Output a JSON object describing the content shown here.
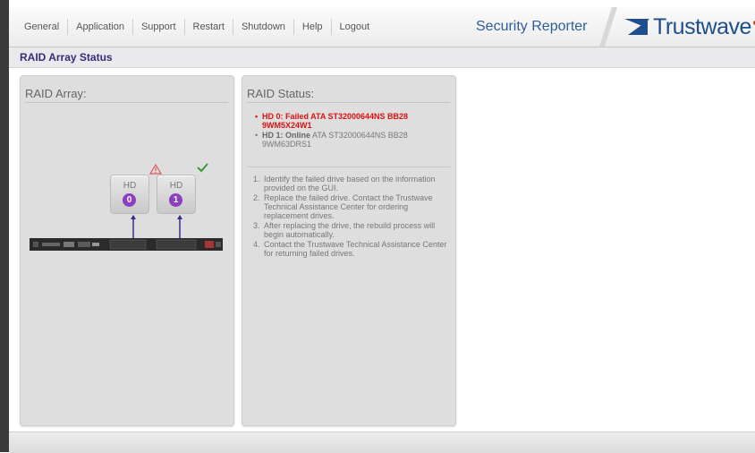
{
  "nav": {
    "items": [
      {
        "label": "General",
        "name": "nav-general"
      },
      {
        "label": "Application",
        "name": "nav-application"
      },
      {
        "label": "Support",
        "name": "nav-support"
      },
      {
        "label": "Restart",
        "name": "nav-restart"
      },
      {
        "label": "Shutdown",
        "name": "nav-shutdown"
      },
      {
        "label": "Help",
        "name": "nav-help"
      },
      {
        "label": "Logout",
        "name": "nav-logout"
      }
    ]
  },
  "brand": {
    "product": "Security Reporter",
    "logo_text": "Trustwave",
    "colors": {
      "logo": "#1e4e8c",
      "product": "#2d5e9a"
    }
  },
  "page": {
    "title": "RAID Array Status"
  },
  "raid_array": {
    "heading": "RAID Array:",
    "drives": [
      {
        "label": "HD",
        "number": "0",
        "status_icon": "warning-icon"
      },
      {
        "label": "HD",
        "number": "1",
        "status_icon": "check-icon"
      }
    ]
  },
  "raid_status": {
    "heading": "RAID Status:",
    "drives": [
      {
        "bullet": "•",
        "text": "HD 0: Failed ATA ST32000644NS BB28 9WM5X24W1",
        "state": "failed"
      },
      {
        "bullet": "•",
        "label": "HD 1: Online",
        "text": " ATA ST32000644NS BB28 9WM63DRS1",
        "state": "online"
      }
    ],
    "steps": [
      {
        "num": "1.",
        "text": "Identify the failed drive based on the information provided on the GUI."
      },
      {
        "num": "2.",
        "text": "Replace the failed drive. Contact the Trustwave Technical Assistance Center for ordering replacement drives."
      },
      {
        "num": "3.",
        "text": "After replacing the drive, the rebuild process will begin automatically."
      },
      {
        "num": "4.",
        "text": "Contact the Trustwave Technical Assistance Center for returning failed drives."
      }
    ]
  }
}
